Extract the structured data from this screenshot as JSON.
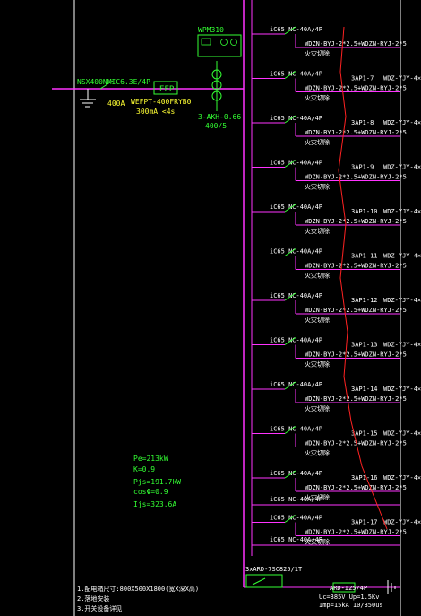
{
  "colors": {
    "background": "#000000",
    "bus": "#ff33ff",
    "wire": "#ff33ff",
    "border": "#ffffff",
    "label": "#ffffff",
    "green": "#33ff33",
    "yellow": "#ffff33",
    "red": "#ff2222",
    "calc": "#33ff33"
  },
  "incoming": {
    "breaker": "NSX400NMIC6.3E/4P",
    "current": "400A",
    "efp": "EFP",
    "meter_tag": "WEFPT-400FRYB0",
    "rcd": "300mA  <4s",
    "ct": "3-AKH-0.66",
    "ct_ratio": "400/5",
    "wpm_title": "WPM310"
  },
  "branch_breaker": "iC65 NC-40A/4P",
  "branch_cable": "WDZN-BYJ-2*2.5+WDZN-RYJ-2*5",
  "branch_note": "火灾切除",
  "right_cable": "WDZ-YJY-4×",
  "branches": [
    {
      "panel": ""
    },
    {
      "panel": "3AP1-7"
    },
    {
      "panel": "3AP1-8"
    },
    {
      "panel": "3AP1-9"
    },
    {
      "panel": "3AP1-10"
    },
    {
      "panel": "3AP1-11"
    },
    {
      "panel": "3AP1-12"
    },
    {
      "panel": "3AP1-13"
    },
    {
      "panel": "3AP1-14"
    },
    {
      "panel": "3AP1-15"
    },
    {
      "panel": "3AP1-16"
    },
    {
      "panel": "3AP1-17"
    }
  ],
  "spare_breaker": "iC65 NC-40A/4P",
  "spd": {
    "breaker": "3xARD-7SC825/1T",
    "name": "ARD-I25/4P",
    "uc": "Uc=385V  Up=1.5Kv",
    "imp": "Imp=15kA 10/350us"
  },
  "calc": {
    "pe": "Pe=213kW",
    "k": "K=0.9",
    "pjs": "Pjs=191.7kW",
    "cos": "cosΦ=0.9",
    "ijs": "Ijs=323.6A"
  },
  "notes": [
    "1.配电箱尺寸:800X500X1800(宽X深X高)",
    "2.落地安装",
    "3.开关设备详见"
  ]
}
